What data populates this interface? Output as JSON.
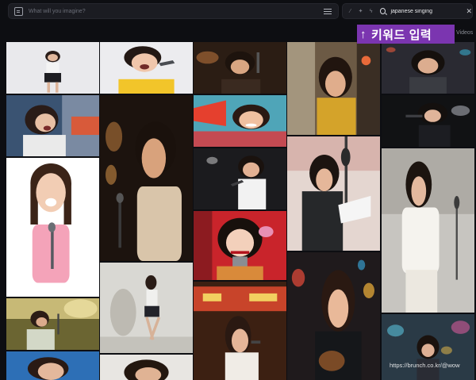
{
  "prompt": {
    "placeholder": "What will you imagine?"
  },
  "search": {
    "value": "japanese singing",
    "clear_glyph": "✕"
  },
  "nav": {
    "videos_label": "Videos"
  },
  "callout": {
    "arrow": "↑",
    "text": "키워드 입력"
  },
  "watermark": "https://brunch.co.kr/@wow",
  "colors": {
    "background": "#0d0e12",
    "bar": "#1b1c22",
    "callout": "#7b35b0"
  }
}
